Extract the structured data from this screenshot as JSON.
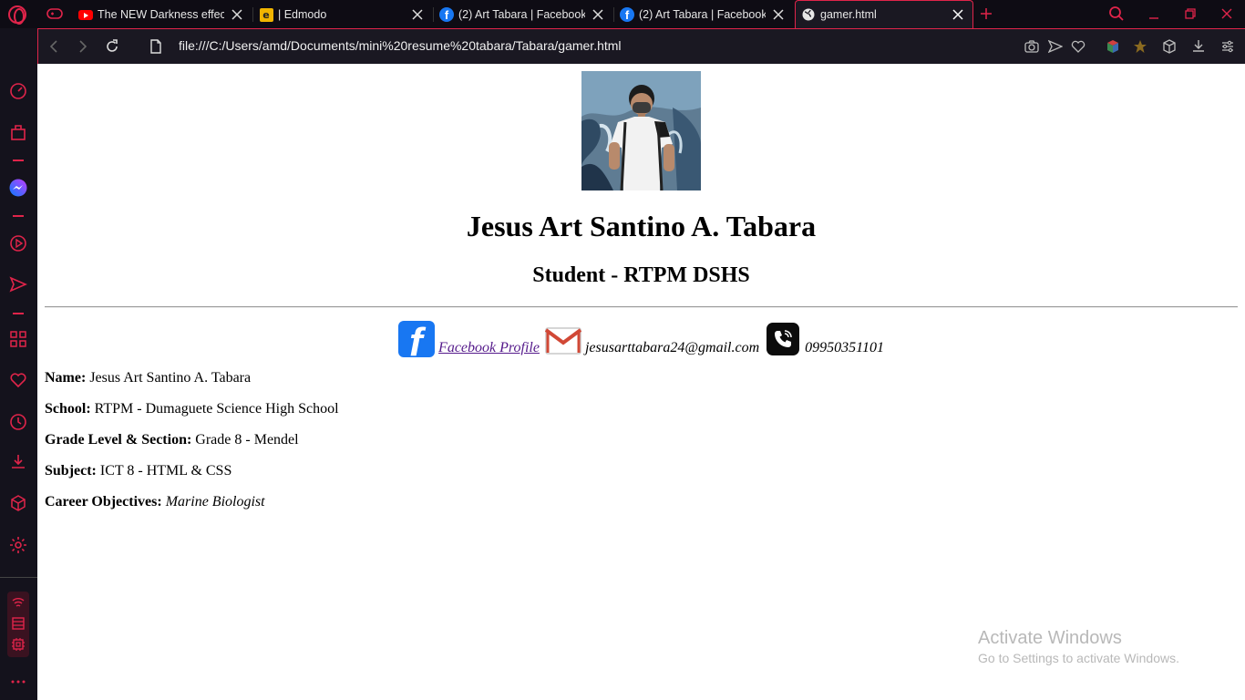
{
  "tabs": [
    {
      "title": "The NEW Darkness effect is",
      "favicon": "youtube-icon"
    },
    {
      "title": "| Edmodo",
      "favicon": "edmodo-icon"
    },
    {
      "title": "(2) Art Tabara | Facebook",
      "favicon": "facebook-icon"
    },
    {
      "title": "(2) Art Tabara | Facebook",
      "favicon": "facebook-icon"
    },
    {
      "title": "gamer.html",
      "favicon": "globe-icon",
      "active": true
    }
  ],
  "address_bar": {
    "url": "file:///C:/Users/amd/Documents/mini%20resume%20tabara/Tabara/gamer.html"
  },
  "page": {
    "name_heading": "Jesus Art Santino A. Tabara",
    "role_heading": "Student - RTPM DSHS",
    "contact": {
      "facebook_link": "Facebook Profile",
      "email": "jesusarttabara24@gmail.com",
      "phone": "09950351101"
    },
    "info": [
      {
        "label": "Name:",
        "value": "Jesus Art Santino A. Tabara",
        "italic": false
      },
      {
        "label": "School:",
        "value": "RTPM - Dumaguete Science High School",
        "italic": false
      },
      {
        "label": "Grade Level & Section:",
        "value": "Grade 8 - Mendel",
        "italic": false
      },
      {
        "label": "Subject:",
        "value": "ICT 8 - HTML & CSS",
        "italic": false
      },
      {
        "label": "Career Objectives:",
        "value": "Marine Biologist",
        "italic": true
      }
    ]
  },
  "watermark": {
    "line1": "Activate Windows",
    "line2": "Go to Settings to activate Windows."
  },
  "colors": {
    "accent": "#e0244a",
    "chrome_bg": "#14121c",
    "link_visited": "#551a8b",
    "facebook_blue": "#1877f2"
  }
}
